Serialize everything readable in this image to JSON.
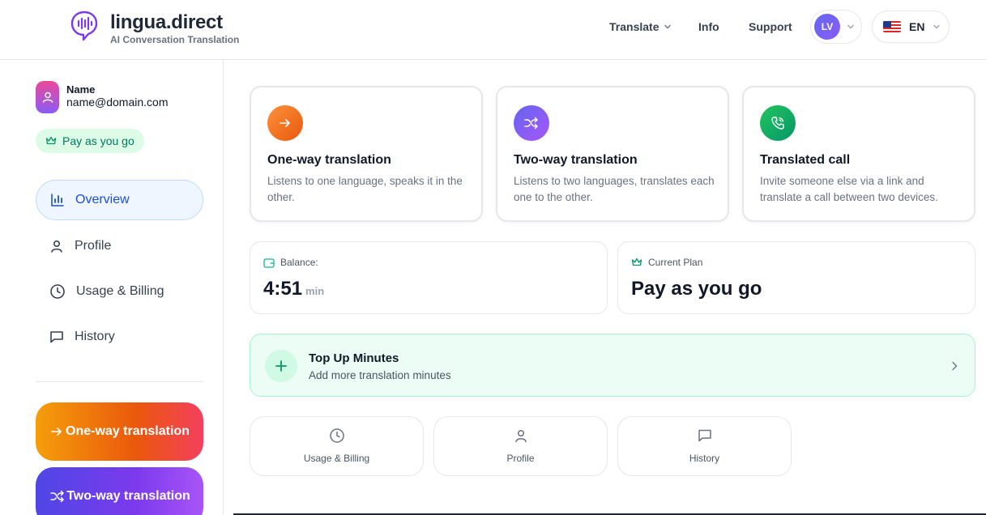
{
  "header": {
    "brand_title": "lingua.direct",
    "brand_subtitle": "AI Conversation Translation",
    "nav": {
      "translate": "Translate",
      "info": "Info",
      "support": "Support"
    },
    "user_initials": "LV",
    "language": "EN",
    "language_flag": "us-flag-icon"
  },
  "sidebar": {
    "user_name": "Name",
    "user_email": "name@domain.com",
    "plan_badge": "Pay as you go",
    "items": [
      {
        "label": "Overview",
        "icon": "bar-chart-icon",
        "active": true
      },
      {
        "label": "Profile",
        "icon": "user-icon",
        "active": false
      },
      {
        "label": "Usage & Billing",
        "icon": "clock-icon",
        "active": false
      },
      {
        "label": "History",
        "icon": "message-icon",
        "active": false
      }
    ],
    "cta_oneway": "One-way translation",
    "cta_twoway": "Two-way translation"
  },
  "features": [
    {
      "title": "One-way translation",
      "desc": "Listens to one language, speaks it in the other.",
      "color": "#f97316"
    },
    {
      "title": "Two-way translation",
      "desc": "Listens to two languages, translates each one to the other.",
      "color": "#6366f1"
    },
    {
      "title": "Translated call",
      "desc": "Invite someone else via a link and translate a call between two devices.",
      "color": "#10b981"
    }
  ],
  "balance": {
    "label": "Balance:",
    "value": "4:51",
    "unit": "min"
  },
  "plan": {
    "label": "Current Plan",
    "value": "Pay as you go"
  },
  "topup": {
    "title": "Top Up Minutes",
    "subtitle": "Add more translation minutes"
  },
  "quick_links": [
    {
      "label": "Usage & Billing",
      "icon": "clock-icon"
    },
    {
      "label": "Profile",
      "icon": "user-icon"
    },
    {
      "label": "History",
      "icon": "message-icon"
    }
  ],
  "colors": {
    "accent_blue": "#1d4ed8",
    "green": "#10b981",
    "orange": "#f97316",
    "indigo": "#6366f1"
  }
}
